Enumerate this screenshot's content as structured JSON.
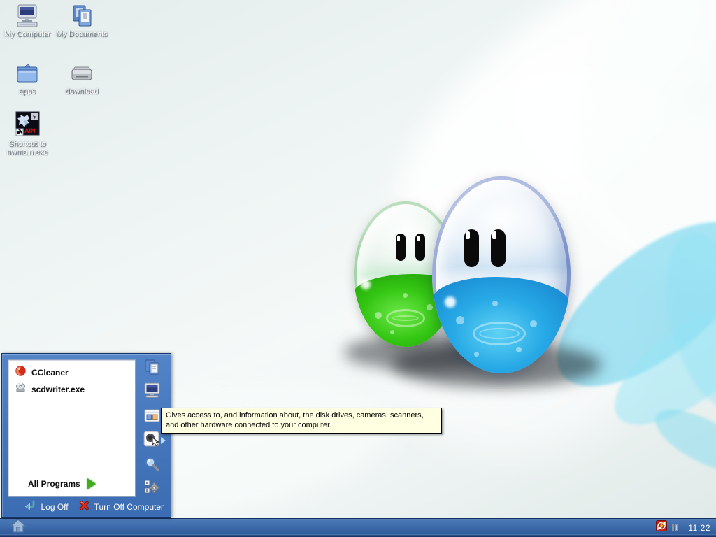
{
  "desktop": {
    "icons": [
      {
        "id": "my-computer",
        "label": "My Computer"
      },
      {
        "id": "my-documents",
        "label": "My Documents"
      },
      {
        "id": "apps",
        "label": "apps"
      },
      {
        "id": "download",
        "label": "download"
      },
      {
        "id": "nwmain-shortcut",
        "label_line1": "Shortcut to",
        "label_line2": "nwmain.exe"
      }
    ]
  },
  "start_menu": {
    "programs": [
      {
        "label": "CCleaner",
        "icon": "ccleaner-icon"
      },
      {
        "label": "scdwriter.exe",
        "icon": "cd-writer-icon"
      }
    ],
    "all_programs_label": "All Programs",
    "right_column_icons": [
      "my-documents-icon",
      "my-computer-icon",
      "control-panel-icon",
      "hardware-devices-icon",
      "search-icon",
      "run-icon"
    ],
    "log_off_label": "Log Off",
    "turn_off_label": "Turn Off Computer"
  },
  "tooltip": {
    "text": "Gives access to, and information about, the disk drives, cameras, scanners, and other hardware connected to your computer."
  },
  "taskbar": {
    "start_button_icon": "home-icon",
    "tray_icons": [
      "sync-lightning-tray-icon",
      "pause-indicator-icon"
    ],
    "clock": "11:22"
  },
  "colors": {
    "taskbar_blue": "#3a67a7",
    "menu_blue": "#4676bc",
    "menu_border": "#16366b",
    "tooltip_bg": "#ffffe1",
    "desktop_light": "#f5f9f8",
    "desktop_dark": "#dfe9e7",
    "mascot_green": "#35c714",
    "mascot_blue": "#27a9e6",
    "all_programs_arrow_green": "#3fae1c",
    "turn_off_red": "#d32f1e",
    "log_off_teal": "#4e90aa"
  }
}
